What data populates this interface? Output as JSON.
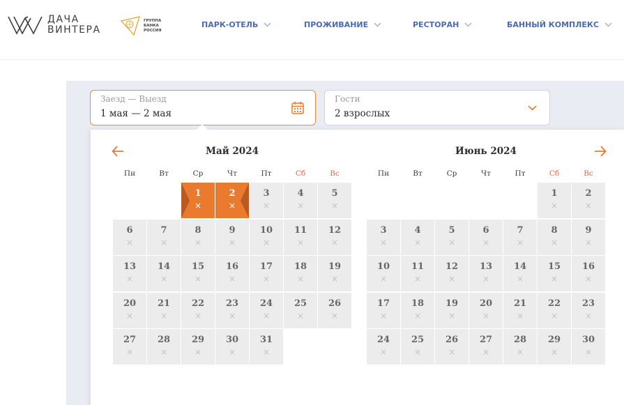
{
  "header": {
    "logo_line1": "ДАЧА",
    "logo_line2": "ВИНТЕРА",
    "bank_line1": "ГРУППА БАНКА",
    "bank_line2": "РОССИЯ",
    "nav": [
      "ПАРК-ОТЕЛЬ",
      "ПРОЖИВАНИЕ",
      "РЕСТОРАН",
      "БАННЫЙ КОМПЛЕКС"
    ]
  },
  "booking": {
    "dates_label": "Заезд — Выезд",
    "dates_value": "1 мая — 2 мая",
    "guests_label": "Гости",
    "guests_value": "2 взрослых"
  },
  "calendar": {
    "weekdays": [
      "Пн",
      "Вт",
      "Ср",
      "Чт",
      "Пт",
      "Сб",
      "Вс"
    ],
    "unavailable_mark": "×",
    "months": [
      {
        "title": "Май 2024",
        "first_weekday_index": 2,
        "days": 31,
        "selected": [
          1,
          2
        ]
      },
      {
        "title": "Июнь 2024",
        "first_weekday_index": 5,
        "days": 30,
        "selected": []
      }
    ]
  },
  "colors": {
    "accent": "#e97a2e",
    "nav": "#4a6bb0",
    "weekend": "#e8643c",
    "day_bg": "#ececec",
    "panel_bg": "#e9ecf3"
  },
  "icons": {
    "prev": "arrow-left-icon",
    "next": "arrow-right-icon",
    "calendar": "calendar-icon",
    "dropdown": "chevron-down-icon"
  }
}
